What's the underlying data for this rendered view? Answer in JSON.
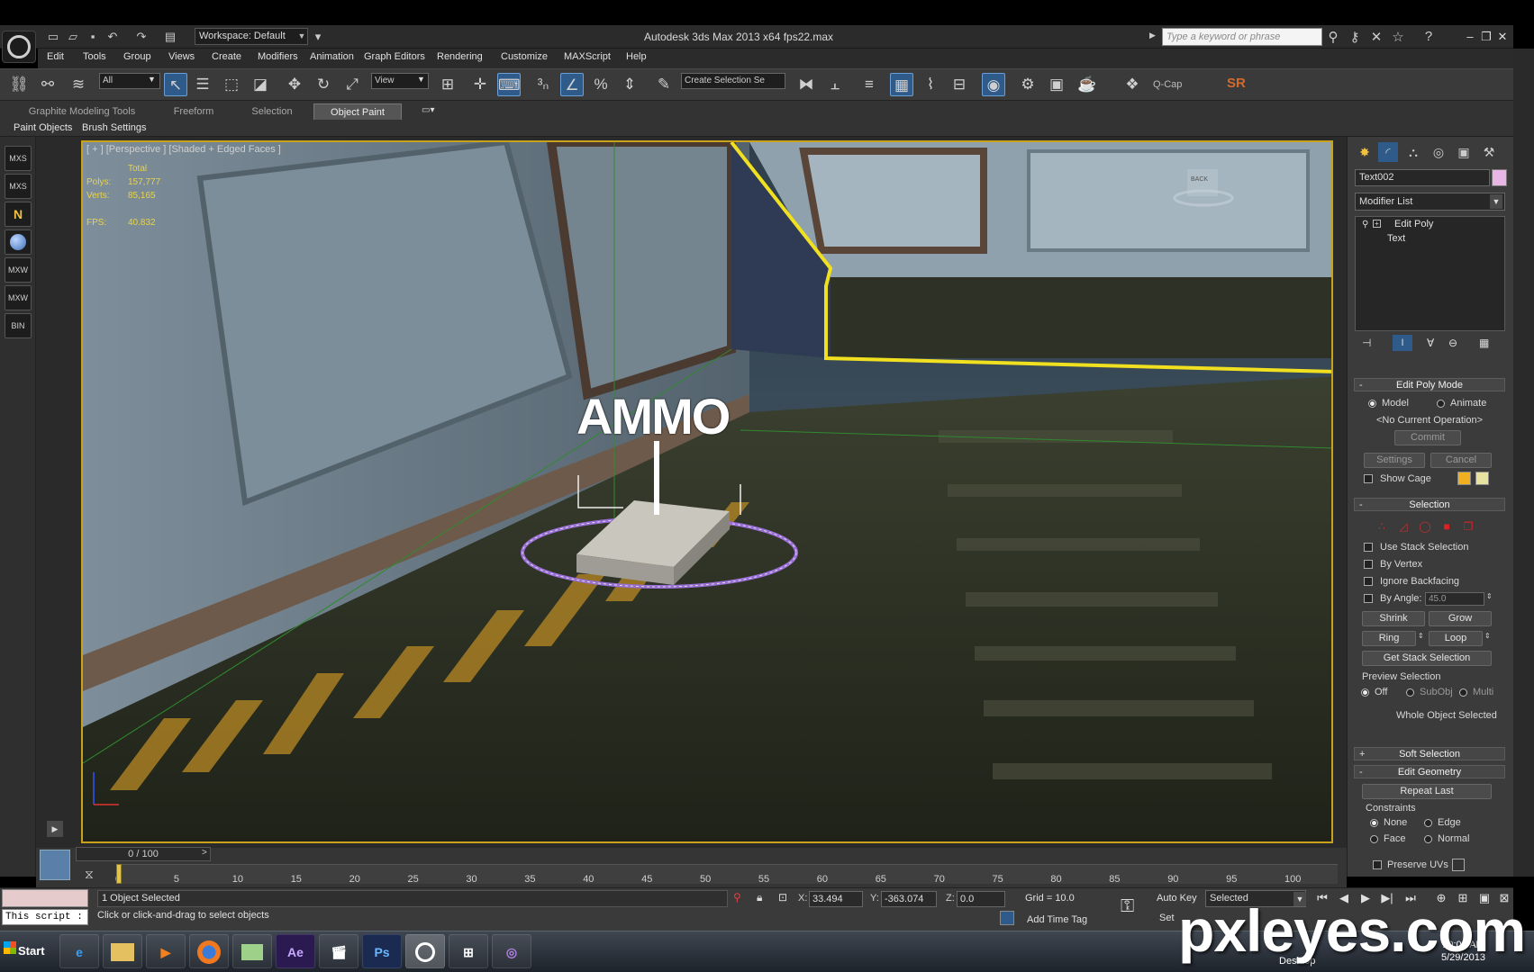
{
  "title_bar": {
    "app_title": "Autodesk 3ds Max  2013 x64     fps22.max",
    "workspace": "Workspace: Default",
    "search_placeholder": "Type a keyword or phrase"
  },
  "menu": [
    "Edit",
    "Tools",
    "Group",
    "Views",
    "Create",
    "Modifiers",
    "Animation",
    "Graph Editors",
    "Rendering",
    "Customize",
    "MAXScript",
    "Help"
  ],
  "toolbar": {
    "selection_filter": "All",
    "ref_coord": "View",
    "named_selection": "Create Selection Se",
    "qcap_label": "Q-Cap",
    "sr_label": "SR"
  },
  "ribbon": {
    "tabs": [
      "Graphite Modeling Tools",
      "Freeform",
      "Selection",
      "Object Paint"
    ],
    "active_tab": "Object Paint",
    "subtabs": [
      "Paint Objects",
      "Brush Settings"
    ]
  },
  "left_strip": [
    "MXS",
    "MXS",
    "N",
    "",
    "MXW",
    "MXW",
    "BIN"
  ],
  "viewport": {
    "label": "[ + ] [Perspective ] [Shaded + Edged Faces ]",
    "stats": {
      "header": "Total",
      "polys_label": "Polys:",
      "polys_value": "157,777",
      "verts_label": "Verts:",
      "verts_value": "85,165",
      "fps_label": "FPS:",
      "fps_value": "40.832"
    },
    "scene_text": "AMMO",
    "viewcube": "BACK"
  },
  "command_panel": {
    "object_name": "Text002",
    "object_color": "#e8b6e4",
    "modifier_list": "Modifier List",
    "stack": [
      "Edit Poly",
      "Text"
    ],
    "edit_poly_mode": {
      "title": "Edit Poly Mode",
      "model": "Model",
      "animate": "Animate",
      "operation": "<No Current Operation>",
      "commit": "Commit",
      "settings": "Settings",
      "cancel": "Cancel",
      "show_cage": "Show Cage"
    },
    "selection": {
      "title": "Selection",
      "use_stack": "Use Stack Selection",
      "by_vertex": "By Vertex",
      "ignore_backfacing": "Ignore Backfacing",
      "by_angle": "By Angle:",
      "angle_value": "45.0",
      "shrink": "Shrink",
      "grow": "Grow",
      "ring": "Ring",
      "loop": "Loop",
      "get_stack": "Get Stack Selection",
      "preview_title": "Preview Selection",
      "off": "Off",
      "subobj": "SubObj",
      "multi": "Multi",
      "whole_object": "Whole Object Selected"
    },
    "soft_selection": "Soft Selection",
    "edit_geometry": {
      "title": "Edit Geometry",
      "repeat_last": "Repeat Last",
      "constraints": "Constraints",
      "none": "None",
      "edge": "Edge",
      "face": "Face",
      "normal": "Normal",
      "preserve_uvs": "Preserve UVs"
    }
  },
  "timeline": {
    "frame_display": "0 / 100",
    "current_frame": 0,
    "total_frames": 100,
    "ticks": [
      "0",
      "5",
      "10",
      "15",
      "20",
      "25",
      "30",
      "35",
      "40",
      "45",
      "50",
      "55",
      "60",
      "65",
      "70",
      "75",
      "80",
      "85",
      "90",
      "95",
      "100"
    ]
  },
  "status": {
    "selected_count": "1 Object Selected",
    "prompt": "Click or click-and-drag to select objects",
    "x_label": "X:",
    "x_value": "33.494",
    "y_label": "Y:",
    "y_value": "-363.074",
    "z_label": "Z:",
    "z_value": "0.0",
    "grid": "Grid = 10.0",
    "auto_key": "Auto Key",
    "key_mode": "Selected",
    "set_key": "Set",
    "add_time_tag": "Add Time Tag",
    "maxscript": "This script :"
  },
  "taskbar": {
    "start": "Start",
    "apps": [
      "e",
      "",
      "▶",
      "",
      "",
      "Ae",
      "",
      "Ps",
      "",
      "",
      ""
    ],
    "clock_time": "10:05 AM",
    "clock_date": "5/29/2013",
    "desktop": "Desktop"
  },
  "watermark": "pxleyes.com"
}
